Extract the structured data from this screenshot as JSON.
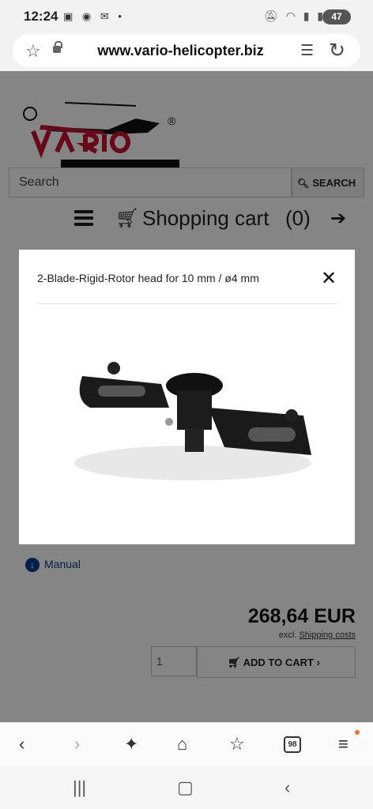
{
  "status_bar": {
    "time": "12:24",
    "left_icons": [
      "screenshot-icon",
      "messenger-icon",
      "gmail-icon",
      "dot-icon"
    ],
    "right_icons": [
      "mute-icon",
      "wifi-icon",
      "signal-icon",
      "signal-icon"
    ],
    "battery": "47"
  },
  "browser": {
    "url": "www.vario-helicopter.biz"
  },
  "site": {
    "search_placeholder": "Search",
    "search_button": "SEARCH",
    "cart_label": "Shopping cart",
    "cart_count": "(0)",
    "manual_label": "Manual",
    "price": "268,64 EUR",
    "excl_prefix": "excl.",
    "shipping_link": "Shipping costs",
    "quantity": "1",
    "add_to_cart": "ADD TO CART",
    "add_to_cart_arrow": "›"
  },
  "modal": {
    "title": "2-Blade-Rigid-Rotor head for 10 mm / ø4 mm",
    "close": "✕"
  },
  "colors": {
    "brand_red": "#c8102e",
    "link_blue": "#0b3d91",
    "overlay": "rgba(0,0,0,0.48)"
  },
  "bottom_nav": {
    "tabs_count": "98"
  }
}
